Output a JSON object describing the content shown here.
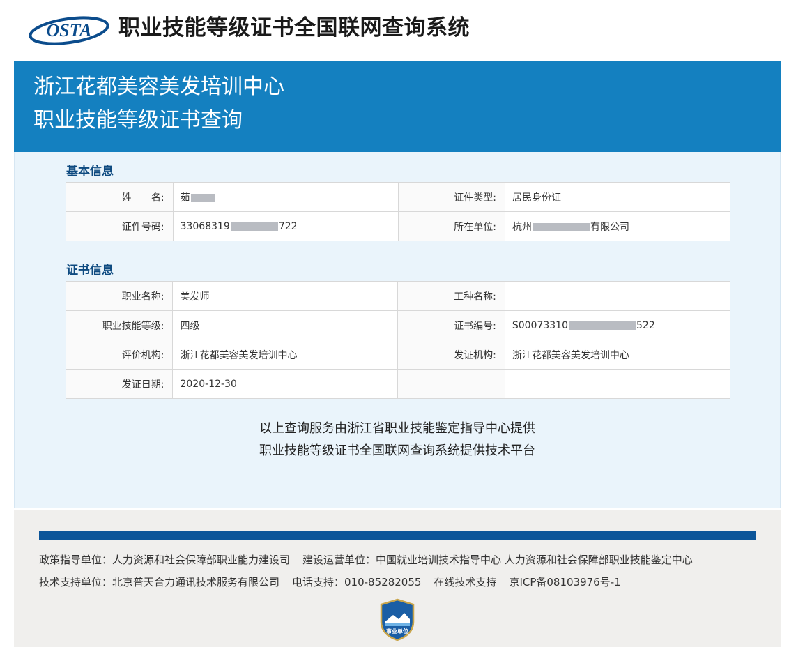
{
  "header": {
    "logo_text": "OSTA",
    "title": "职业技能等级证书全国联网查询系统"
  },
  "banner": {
    "line1": "浙江花都美容美发培训中心",
    "line2": "职业技能等级证书查询"
  },
  "basic_info": {
    "section_title": "基本信息",
    "rows": [
      {
        "label1": "姓　　名:",
        "value1": "茹",
        "label2": "证件类型:",
        "value2": "居民身份证"
      },
      {
        "label1": "证件号码:",
        "value1": "33068319",
        "value1_tail": "722",
        "label2": "所在单位:",
        "value2": "杭州",
        "value2_tail": "有限公司"
      }
    ]
  },
  "cert_info": {
    "section_title": "证书信息",
    "rows": [
      {
        "label1": "职业名称:",
        "value1": "美发师",
        "label2": "工种名称:",
        "value2": ""
      },
      {
        "label1": "职业技能等级:",
        "value1": "四级",
        "label2": "证书编号:",
        "value2": "S00073310",
        "value2_tail": "522"
      },
      {
        "label1": "评价机构:",
        "value1": "浙江花都美容美发培训中心",
        "label2": "发证机构:",
        "value2": "浙江花都美容美发培训中心"
      },
      {
        "label1": "发证日期:",
        "value1": "2020-12-30",
        "label2": "",
        "value2": ""
      }
    ]
  },
  "notes": {
    "line1": "以上查询服务由浙江省职业技能鉴定指导中心提供",
    "line2": "职业技能等级证书全国联网查询系统提供技术平台"
  },
  "footer": {
    "policy_unit": "政策指导单位：人力资源和社会保障部职业能力建设司",
    "operator_unit": "建设运营单位：中国就业培训技术指导中心  人力资源和社会保障部职业技能鉴定中心",
    "tech_support": "技术支持单位：北京普天合力通讯技术服务有限公司",
    "phone": "电话支持：010-85282055",
    "online_support": "在线技术支持",
    "icp": "京ICP备08103976号-1",
    "badge_text": "事业单位"
  },
  "colors": {
    "banner": "#1480c0",
    "section_title": "#0e4a80",
    "footer_bar": "#0c5599"
  }
}
